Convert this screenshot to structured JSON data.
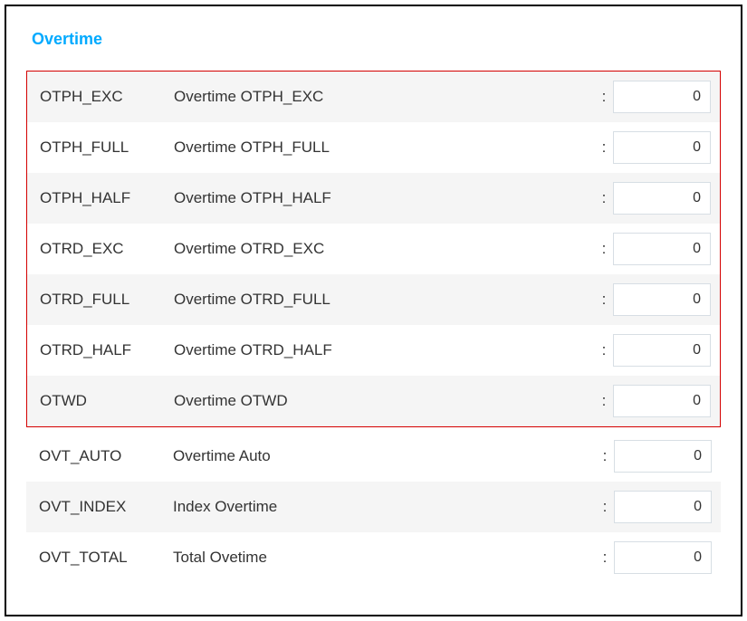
{
  "section": {
    "title": "Overtime"
  },
  "rows": [
    {
      "code": "OTPH_EXC",
      "description": "Overtime OTPH_EXC",
      "value": "0",
      "highlighted": true,
      "alt": true
    },
    {
      "code": "OTPH_FULL",
      "description": "Overtime OTPH_FULL",
      "value": "0",
      "highlighted": true,
      "alt": false
    },
    {
      "code": "OTPH_HALF",
      "description": "Overtime OTPH_HALF",
      "value": "0",
      "highlighted": true,
      "alt": true
    },
    {
      "code": "OTRD_EXC",
      "description": "Overtime OTRD_EXC",
      "value": "0",
      "highlighted": true,
      "alt": false
    },
    {
      "code": "OTRD_FULL",
      "description": "Overtime OTRD_FULL",
      "value": "0",
      "highlighted": true,
      "alt": true
    },
    {
      "code": "OTRD_HALF",
      "description": "Overtime OTRD_HALF",
      "value": "0",
      "highlighted": true,
      "alt": false
    },
    {
      "code": "OTWD",
      "description": "Overtime OTWD",
      "value": "0",
      "highlighted": true,
      "alt": true
    },
    {
      "code": "OVT_AUTO",
      "description": "Overtime Auto",
      "value": "0",
      "highlighted": false,
      "alt": false
    },
    {
      "code": "OVT_INDEX",
      "description": "Index Overtime",
      "value": "0",
      "highlighted": false,
      "alt": true
    },
    {
      "code": "OVT_TOTAL",
      "description": "Total Ovetime",
      "value": "0",
      "highlighted": false,
      "alt": false
    }
  ],
  "colon": ":"
}
